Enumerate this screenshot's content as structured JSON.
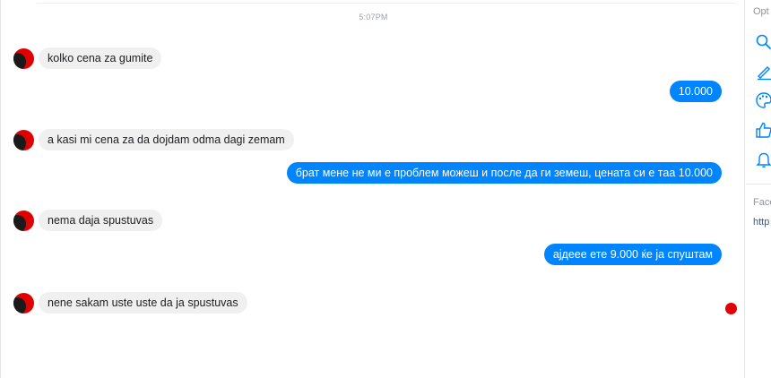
{
  "thread": {
    "timestamp": "5:07PM",
    "messages": [
      {
        "direction": "in",
        "text": "kolko cena za gumite"
      },
      {
        "direction": "out",
        "text": "10.000"
      },
      {
        "direction": "in",
        "text": "a kasi mi cena za da dojdam odma dagi zemam"
      },
      {
        "direction": "out",
        "text": "брат мене не ми  е проблем можеш и после да ги земеш, цената си е таа 10.000"
      },
      {
        "direction": "in",
        "text": "nema daja spustuvas"
      },
      {
        "direction": "out",
        "text": "ајдеее ете 9.000 ќе ја спуштам"
      },
      {
        "direction": "in",
        "text": "nene sakam uste uste da ja spustuvas"
      }
    ]
  },
  "sidebar": {
    "options_label": "Opt",
    "section_label": "Face",
    "link_text": "http",
    "icons": [
      "search-icon",
      "pencil-icon",
      "palette-icon",
      "thumbs-up-icon",
      "bell-icon"
    ],
    "accent_color": "#0084ff"
  },
  "colors": {
    "outgoing_bubble": "#0084ff",
    "incoming_bubble": "#f1f0f0",
    "avatar": "#e10000"
  }
}
